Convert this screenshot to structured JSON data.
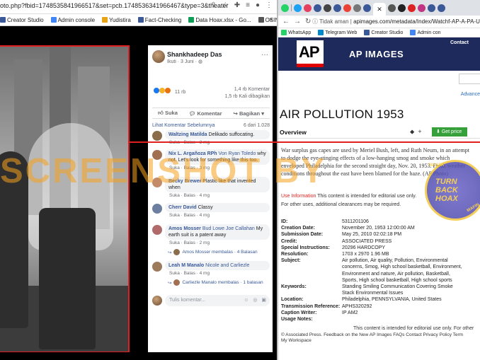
{
  "left_window": {
    "url": "oto.php?fbid=1748535841966517&set=pcb.1748536341966467&type=3&theater",
    "bookmarks": [
      {
        "label": "Creator Studio",
        "color": "#3b5998"
      },
      {
        "label": "Admin console",
        "color": "#4285f4"
      },
      {
        "label": "Yudistira",
        "color": "#e8a317"
      },
      {
        "label": "Fact-Checking",
        "color": "#3b5998"
      },
      {
        "label": "Data Hoax.xlsx - Go...",
        "color": "#0f9d58"
      },
      {
        "label": "OSINT Framework",
        "color": "#555555"
      }
    ],
    "post": {
      "author": "Shankhadeep Das",
      "meta": "Ikuti · 3 Juni · ",
      "reaction_count": "11 rb",
      "comment_count": "1,4 rb Komentar",
      "share_count": "1,5 rb Kali dibagikan",
      "actions": {
        "like": "Suka",
        "comment": "Komentar",
        "share": "Bagikan"
      },
      "view_previous": "Lihat Komentar Sebelumnya",
      "comments_range": "6 dari 1.028",
      "input_placeholder": "Tulis komentar..."
    },
    "comments": [
      {
        "name": "Waltzing Matilda",
        "text": "Delikado suffocating.",
        "meta": "Suka · Balas · 3 mg"
      },
      {
        "name": "Nix L. Argañoza RPh",
        "tag": "Von Ryan Toledo",
        "text": "why not. Let's look for something like this too.",
        "meta": "Suka · Balas · 3 mg"
      },
      {
        "name": "Becky Brewer",
        "text": "Plastic like that invented when",
        "meta": "Suka · Balas · 4 mg"
      },
      {
        "name": "Cherr David",
        "text": "Classy",
        "meta": "Suka · Balas · 4 mg"
      },
      {
        "name": "Amos Mosser",
        "tag": "Bud Lowe Joe Callahan",
        "text": "My earth suit is a patent away",
        "meta": "Suka · Balas · 2 mg",
        "reply": "Amos Mosser membalas · 4 Balasan"
      },
      {
        "name": "Leah M Manalo",
        "tag": "Nicole and Carliezle",
        "text": "",
        "meta": "Suka · Balas · 4 mg",
        "reply": "Carliezle Manalo membalas · 1 balasan"
      }
    ]
  },
  "right_window": {
    "address_prefix": "Tidak aman",
    "address": "apimages.com/metadata/Index/Watchf-AP-A-PA-USA-AP",
    "bookmarks": [
      "WhatsApp",
      "Telegram Web",
      "Creator Studio",
      "Admin con"
    ],
    "header": {
      "logo": "AP",
      "title": "AP IMAGES",
      "contact": "Contact"
    },
    "advanced_link": "Advance",
    "title": "AIR POLLUTION 1953",
    "overview_tab": "Overview",
    "get_price": "Get price",
    "caption": "War surplus gas capes are used by Meriel Bush, left, and Ruth Neum, in an attempt to dodge the eye-stinging effects of a low-hanging smog and smoke which enveloped Philadelphia for the second straight day, Nov. 20, 1953. Freak weather conditions throughout the east have been blamed for the haze. (AP Photo)",
    "usage_label": "Use Information",
    "usage_text": " This content is intended for editorial use only.",
    "usage_text2": "For other uses, additional clearances may be required.",
    "metadata": [
      {
        "k": "ID:",
        "v": "5311201106"
      },
      {
        "k": "Creation Date:",
        "v": "November 20, 1953 12:00:00 AM"
      },
      {
        "k": "Submission Date:",
        "v": "May 25, 2010 02:02:18 PM"
      },
      {
        "k": "Credit:",
        "v": "ASSOCIATED PRESS"
      },
      {
        "k": "Special Instructions:",
        "v": "20296 HARDCOPY"
      },
      {
        "k": "Resolution:",
        "v": "1703 x 2970 1.96 MB"
      },
      {
        "k": "Subject:",
        "v": "Air pollution, Air quality, Pollution, Environmental concerns, Smog, High school basketball, Environment, Environment and nature, Air pollution, Basketball, Sports, High school basketball, High school sports"
      },
      {
        "k": "Keywords:",
        "v": "Standing Smiling Communication Covering Smoke Stack Environmental Issues"
      },
      {
        "k": "Location:",
        "v": "Philadelphia, PENNSYLVANIA, United States"
      },
      {
        "k": "Transmission Reference:",
        "v": "APHS320292"
      },
      {
        "k": "Caption Writer:",
        "v": "IP AM2"
      },
      {
        "k": "Usage Notes:",
        "v": ""
      }
    ],
    "usage_note_text": "This content is intended for editorial use only. For other",
    "footer_links": "© Associated Press.   Feedback on the New AP Images   FAQs   Contact   Privacy Policy   Term",
    "footer_line2": "My Workspace"
  },
  "overlay": {
    "watermark": "SCREENSHOT BY",
    "stamp_main": "TURN\nBACK\nHOAX",
    "stamp_top": "MASYA",
    "stamp_bottom": "MAFIN"
  },
  "colors": {
    "fb_blue": "#385898",
    "ap_navy": "#1e2a5c",
    "ap_red": "#e10000",
    "get_price_green": "#36a03a",
    "annotation_red": "#e02020"
  }
}
